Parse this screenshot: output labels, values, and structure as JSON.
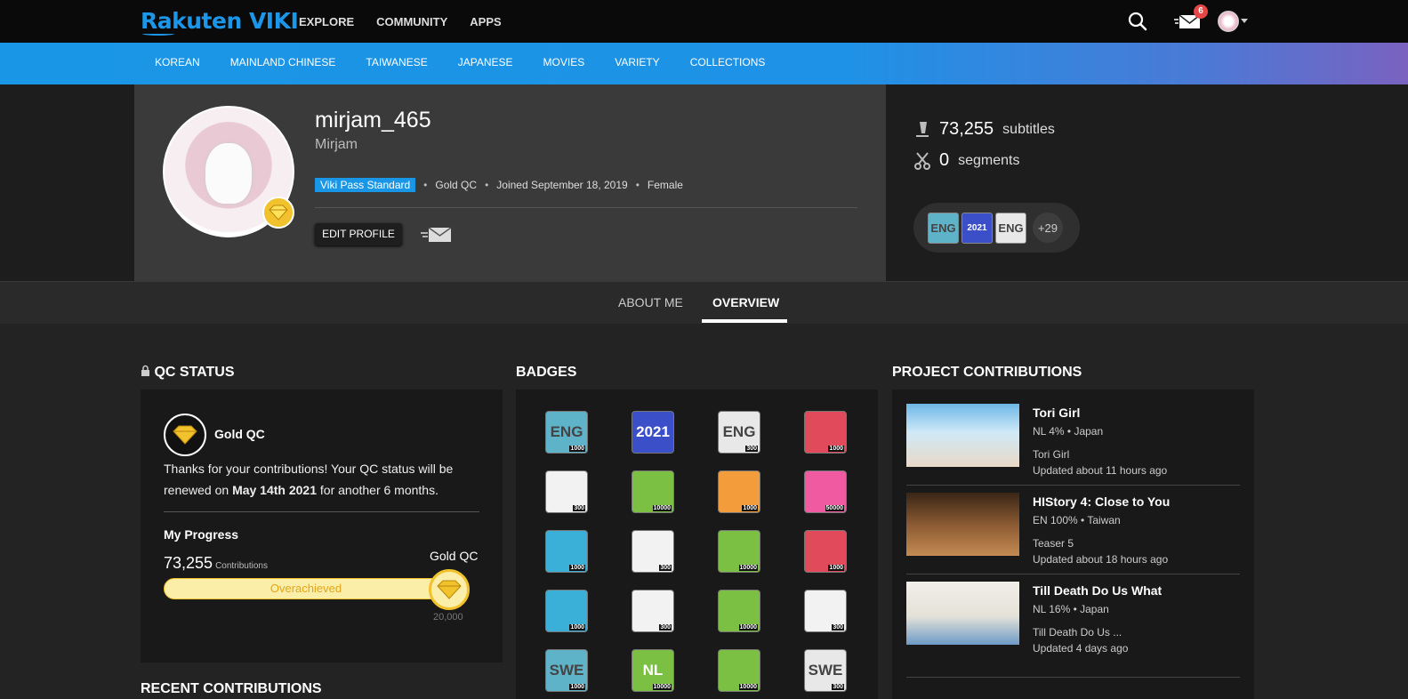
{
  "topbar": {
    "logo": "Rakuten VIKI",
    "nav": [
      "EXPLORE",
      "COMMUNITY",
      "APPS"
    ],
    "mail_count": "6"
  },
  "categories": [
    "KOREAN",
    "MAINLAND CHINESE",
    "TAIWANESE",
    "JAPANESE",
    "MOVIES",
    "VARIETY",
    "COLLECTIONS"
  ],
  "profile": {
    "username": "mirjam_465",
    "display_name": "Mirjam",
    "pass_badge": "Viki Pass Standard",
    "qc_level": "Gold QC",
    "joined": "Joined September 18, 2019",
    "gender": "Female",
    "edit_label": "EDIT PROFILE"
  },
  "stats": {
    "subtitles_num": "73,255",
    "subtitles_lbl": "subtitles",
    "segments_num": "0",
    "segments_lbl": "segments",
    "badge_more": "+29",
    "mini_badges": [
      "ENG",
      "2021",
      "ENG"
    ]
  },
  "tabs": {
    "about": "ABOUT ME",
    "overview": "OVERVIEW"
  },
  "qc": {
    "title": "QC STATUS",
    "status_name": "Gold QC",
    "text_before": "Thanks for your contributions! Your QC status will be renewed on ",
    "date": "May 14th 2021",
    "text_after": " for another 6 months.",
    "progress_title": "My Progress",
    "contributions": "73,255",
    "contributions_lbl": "Contributions",
    "goal": "Gold QC",
    "bar_text": "Overachieved",
    "goal_value": "20,000",
    "progress_fraction": 1.0
  },
  "recent_title": "RECENT CONTRIBUTIONS",
  "badges": {
    "title": "BADGES",
    "items": [
      {
        "label": "ENG",
        "count": "1000",
        "color": "#5fb3c9"
      },
      {
        "label": "2021",
        "count": "",
        "color": "#3b4fc9"
      },
      {
        "label": "ENG",
        "count": "300",
        "color": "#e8e8e8"
      },
      {
        "label": "",
        "count": "1000",
        "color": "#e04a5a"
      },
      {
        "label": "",
        "count": "300",
        "color": "#f2f2f2"
      },
      {
        "label": "",
        "count": "10000",
        "color": "#7bc043"
      },
      {
        "label": "",
        "count": "1000",
        "color": "#f39c3c"
      },
      {
        "label": "",
        "count": "50000",
        "color": "#ef5aa0"
      },
      {
        "label": "",
        "count": "1000",
        "color": "#3ab0d9"
      },
      {
        "label": "",
        "count": "300",
        "color": "#f2f2f2"
      },
      {
        "label": "",
        "count": "10000",
        "color": "#7bc043"
      },
      {
        "label": "",
        "count": "1000",
        "color": "#e04a5a"
      },
      {
        "label": "",
        "count": "1000",
        "color": "#3ab0d9"
      },
      {
        "label": "",
        "count": "300",
        "color": "#f2f2f2"
      },
      {
        "label": "",
        "count": "10000",
        "color": "#7bc043"
      },
      {
        "label": "",
        "count": "300",
        "color": "#f2f2f2"
      },
      {
        "label": "SWE",
        "count": "1000",
        "color": "#5fb3c9"
      },
      {
        "label": "NL",
        "count": "10000",
        "color": "#7bc043"
      },
      {
        "label": "",
        "count": "10000",
        "color": "#7bc043"
      },
      {
        "label": "SWE",
        "count": "300",
        "color": "#e8e8e8"
      }
    ]
  },
  "projects": {
    "title": "PROJECT CONTRIBUTIONS",
    "items": [
      {
        "title": "Tori Girl",
        "meta": "NL 4% • Japan",
        "episode": "Tori Girl",
        "updated": "Updated about 11 hours ago"
      },
      {
        "title": "HIStory 4: Close to You",
        "meta": "EN 100% • Taiwan",
        "episode": "Teaser 5",
        "updated": "Updated about 18 hours ago"
      },
      {
        "title": "Till Death Do Us What",
        "meta": "NL 16% • Japan",
        "episode": "Till Death Do Us ...",
        "updated": "Updated 4 days ago"
      }
    ]
  }
}
